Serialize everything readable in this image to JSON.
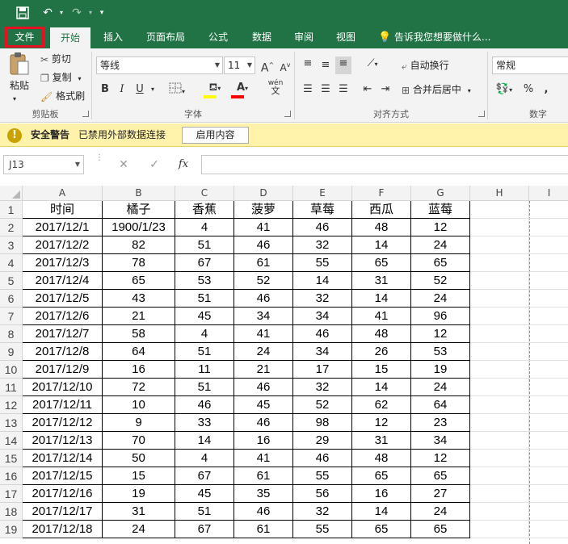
{
  "qat": {
    "save_icon": "save-icon",
    "undo_icon": "undo-icon",
    "redo_icon": "redo-icon",
    "customize_icon": "customize-icon"
  },
  "tabs": [
    {
      "id": "file",
      "label": "文件"
    },
    {
      "id": "home",
      "label": "开始"
    },
    {
      "id": "insert",
      "label": "插入"
    },
    {
      "id": "layout",
      "label": "页面布局"
    },
    {
      "id": "formulas",
      "label": "公式"
    },
    {
      "id": "data",
      "label": "数据"
    },
    {
      "id": "review",
      "label": "审阅"
    },
    {
      "id": "view",
      "label": "视图"
    }
  ],
  "tell_me": "告诉我您想要做什么...",
  "ribbon": {
    "clipboard": {
      "paste": "粘贴",
      "cut": "剪切",
      "copy": "复制",
      "format_painter": "格式刷",
      "label": "剪贴板"
    },
    "font": {
      "name": "等线",
      "size": "11",
      "grow": "A",
      "shrink": "A",
      "bold": "B",
      "italic": "I",
      "underline": "U",
      "phonetic": "wén",
      "label": "字体",
      "fill_color": "#ffff00",
      "font_color": "#ff0000"
    },
    "alignment": {
      "wrap": "自动换行",
      "merge": "合并后居中",
      "label": "对齐方式"
    },
    "number": {
      "format": "常规",
      "percent": "%",
      "comma": ",",
      "label": "数字"
    }
  },
  "security": {
    "title": "安全警告",
    "message": "已禁用外部数据连接",
    "enable_button": "启用内容"
  },
  "formula_bar": {
    "name_box": "J13",
    "cancel": "✕",
    "enter": "✓",
    "fx": "fx",
    "value": ""
  },
  "sheet": {
    "columns": [
      "A",
      "B",
      "C",
      "D",
      "E",
      "F",
      "G",
      "H",
      "I"
    ],
    "row_numbers": [
      "1",
      "2",
      "3",
      "4",
      "5",
      "6",
      "7",
      "8",
      "9",
      "10",
      "11",
      "12",
      "13",
      "14",
      "15",
      "16",
      "17",
      "18",
      "19"
    ],
    "rows": [
      [
        "时间",
        "橘子",
        "香蕉",
        "菠萝",
        "草莓",
        "西瓜",
        "蓝莓"
      ],
      [
        "2017/12/1",
        "1900/1/23",
        "4",
        "41",
        "46",
        "48",
        "12"
      ],
      [
        "2017/12/2",
        "82",
        "51",
        "46",
        "32",
        "14",
        "24"
      ],
      [
        "2017/12/3",
        "78",
        "67",
        "61",
        "55",
        "65",
        "65"
      ],
      [
        "2017/12/4",
        "65",
        "53",
        "52",
        "14",
        "31",
        "52"
      ],
      [
        "2017/12/5",
        "43",
        "51",
        "46",
        "32",
        "14",
        "24"
      ],
      [
        "2017/12/6",
        "21",
        "45",
        "34",
        "34",
        "41",
        "96"
      ],
      [
        "2017/12/7",
        "58",
        "4",
        "41",
        "46",
        "48",
        "12"
      ],
      [
        "2017/12/8",
        "64",
        "51",
        "24",
        "34",
        "26",
        "53"
      ],
      [
        "2017/12/9",
        "16",
        "11",
        "21",
        "17",
        "15",
        "19"
      ],
      [
        "2017/12/10",
        "72",
        "51",
        "46",
        "32",
        "14",
        "24"
      ],
      [
        "2017/12/11",
        "10",
        "46",
        "45",
        "52",
        "62",
        "64"
      ],
      [
        "2017/12/12",
        "9",
        "33",
        "46",
        "98",
        "12",
        "23"
      ],
      [
        "2017/12/13",
        "70",
        "14",
        "16",
        "29",
        "31",
        "34"
      ],
      [
        "2017/12/14",
        "50",
        "4",
        "41",
        "46",
        "48",
        "12"
      ],
      [
        "2017/12/15",
        "15",
        "67",
        "61",
        "55",
        "65",
        "65"
      ],
      [
        "2017/12/16",
        "19",
        "45",
        "35",
        "56",
        "16",
        "27"
      ],
      [
        "2017/12/17",
        "31",
        "51",
        "46",
        "32",
        "14",
        "24"
      ],
      [
        "2017/12/18",
        "24",
        "67",
        "61",
        "55",
        "65",
        "65"
      ]
    ]
  }
}
